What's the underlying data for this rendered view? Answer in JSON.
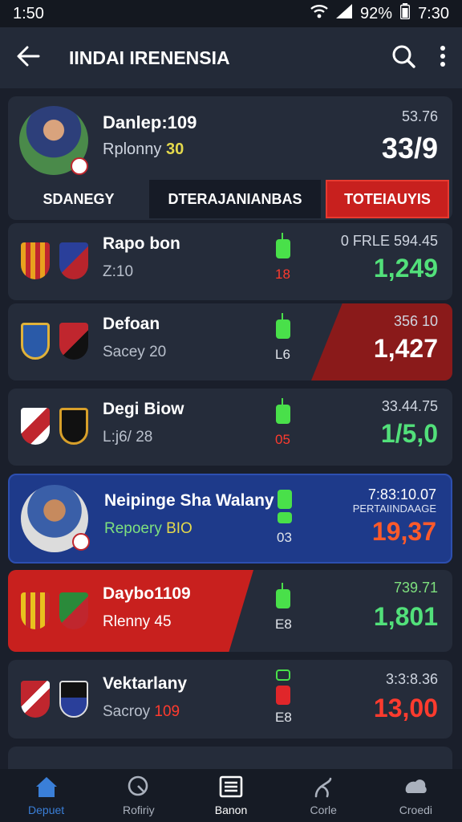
{
  "status": {
    "time_left": "1:50",
    "battery": "92%",
    "time_right": "7:30"
  },
  "header": {
    "title": "IINDAI IRENENSIA"
  },
  "hero": {
    "name": "Danlep:109",
    "sub_label": "Rplonny",
    "sub_value": "30",
    "small": "53.76",
    "big": "33/9",
    "tabs": [
      "SDANEGY",
      "DTERAJANIANBAS",
      "TOTEIAUYIS"
    ]
  },
  "rows": [
    {
      "name": "Rapo bon",
      "sub": "Z:10",
      "ind_num": "18",
      "small": "0 FRLE 594.45",
      "big": "1,249"
    },
    {
      "name": "Defoan",
      "sub": "Sacey 20",
      "ind_num": "L6",
      "small": "356 10",
      "big": "1,427"
    },
    {
      "name": "Degi Biow",
      "sub": "L:j6/ 28",
      "ind_num": "05",
      "small": "33.44.75",
      "big": "1/5,0"
    },
    {
      "name": "Neipinge Sha Walany",
      "sub_label": "Repoery",
      "sub_value": "BIO",
      "ind_num": "03",
      "small": "7:83:10.07",
      "extra": "PERTAIINDAAGE",
      "big": "19,37"
    },
    {
      "name": "Daybo1109",
      "sub": "Rlenny 45",
      "ind_num": "E8",
      "small": "739.71",
      "big": "1,801"
    },
    {
      "name": "Vektarlany",
      "sub_label": "Sacroy",
      "sub_value": "109",
      "ind_num": "E8",
      "small": "3:3:8.36",
      "big": "13,00"
    }
  ],
  "nav": [
    "Depuet",
    "Rofiriy",
    "Banon",
    "Corle",
    "Croedi"
  ],
  "colors": {
    "accent_red": "#c8201e",
    "accent_blue": "#1e3a8a",
    "positive_green": "#52e07a",
    "negative_orange": "#ff5a2a"
  }
}
